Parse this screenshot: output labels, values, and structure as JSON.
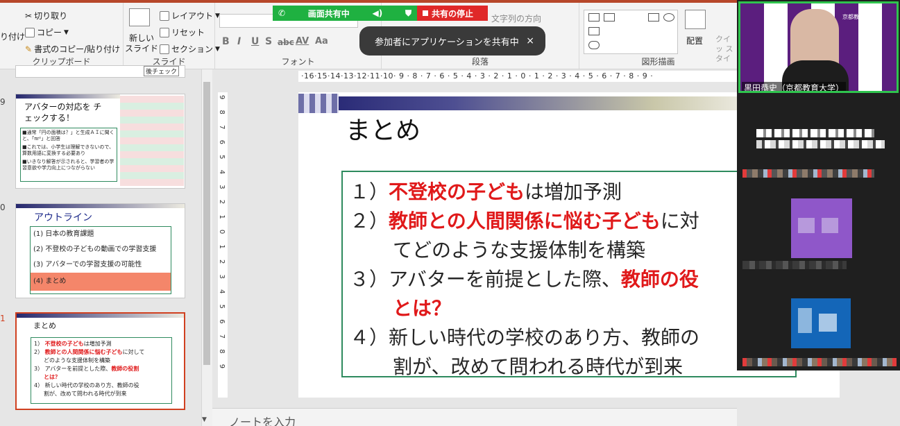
{
  "ribbon": {
    "clipboard": {
      "cut": "切り取り",
      "copy": "コピー",
      "format_painter": "書式のコピー/貼り付け",
      "paste_partial": "り付け",
      "label": "クリップボード"
    },
    "slides": {
      "new_slide_line1": "新しい",
      "new_slide_line2": "スライド",
      "layout": "レイアウト",
      "reset": "リセット",
      "section": "セクション",
      "label": "スライド"
    },
    "font": {
      "bold": "B",
      "italic": "I",
      "underline": "U",
      "shadow": "S",
      "strike": "abc",
      "spacing": "AV",
      "case": "Aa",
      "label": "フォント"
    },
    "paragraph": {
      "text_direction": "文字列の方向",
      "label": "段落"
    },
    "drawing": {
      "arrange": "配置",
      "quick_styles": "クイッ スタイ",
      "label": "図形描画"
    }
  },
  "share": {
    "status": "画面共有中",
    "stop": "共有の停止",
    "toast": "参加者にアプリケーションを共有中",
    "toast_close": "×"
  },
  "thumbnails": {
    "partial_top": "後チェック",
    "slide9": {
      "num": "9",
      "title": "アバターの対応を チェックする！",
      "bullets": [
        "■通常「円の面積は？」と生成ＡＩに聞くと、「πr²」と回答",
        "■これでは、小学生は理解できないので、算数用語に変換する必要あり",
        "■いきなり解答が示されると、学習者の学習意欲や学力向上につながらない"
      ]
    },
    "slide10": {
      "num": "0",
      "title": "アウトライン",
      "items": [
        "(1) 日本の教育課題",
        "(2) 不登校の子どもの動画での学習支援",
        "(3) アバターでの学習支援の可能性",
        "(4) まとめ"
      ]
    },
    "slide11": {
      "num": "1",
      "title": "まとめ",
      "l1a": "1） ",
      "l1b": "不登校の子ども",
      "l1c": "は増加予測",
      "l2a": "2） ",
      "l2b": "教師との人間関係に悩む子ども",
      "l2c": "に対して",
      "l2d": "どのような支援体制を構築",
      "l3a": "3） アバターを前提とした際、",
      "l3b": "教師の役割",
      "l3d": "とは？",
      "l4a": "4） 新しい時代の学校のあり方、教師の役",
      "l4b": "割が、改めて問われる時代が到来"
    }
  },
  "editor": {
    "ruler": "·16·15·14·13·12·11·10· 9 · 8 · 7 · 6 · 5 · 4 · 3 · 2 · 1 · 0 · 1 · 2 · 3 · 4 · 5 · 6 · 7 · 8 · 9 ·",
    "vruler": "9 8 7 6 5 4 3 2 1 0 1 2 3 4 5 6 7 8 9",
    "notes_placeholder": "ノートを入力",
    "slide": {
      "title": "まとめ",
      "item1_num": "１）",
      "item1_red": "不登校の子ども",
      "item1_rest": "は増加予測",
      "item2_num": "２）",
      "item2_red": "教師との人間関係に悩む子ども",
      "item2_rest": "に対",
      "item2_line2": "てどのような支援体制を構築",
      "item3_num": "３）",
      "item3_text": "アバターを前提とした際、",
      "item3_red": "教師の役",
      "item3_line2": "とは？",
      "item4_num": "４）",
      "item4_text": "新しい時代の学校のあり方、教師の",
      "item4_line2": "割が、改めて問われる時代が到来"
    }
  },
  "video": {
    "speaker_name": "黒田恭史（京都教育大学）",
    "banner_text": "京都教育大学"
  },
  "colors": {
    "accent_red": "#e0191a",
    "share_green": "#1fb141",
    "share_red": "#e02828",
    "outline_highlight": "#f4866a",
    "slide_box_border": "#2e8a5e",
    "selected_thumb_border": "#d04020"
  }
}
